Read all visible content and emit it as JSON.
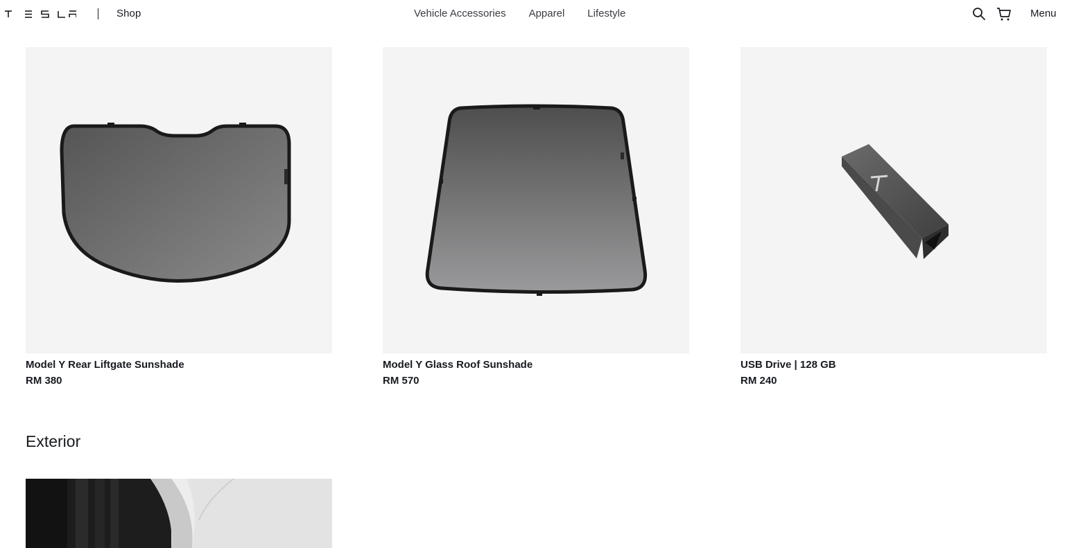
{
  "header": {
    "shop_label": "Shop",
    "nav": [
      "Vehicle Accessories",
      "Apparel",
      "Lifestyle"
    ],
    "menu_label": "Menu",
    "icons": [
      "tesla-logo",
      "search-icon",
      "cart-icon"
    ]
  },
  "products": [
    {
      "name": "Model Y Rear Liftgate Sunshade",
      "price": "RM 380",
      "image": "liftgate-sunshade-image"
    },
    {
      "name": "Model Y Glass Roof Sunshade",
      "price": "RM 570",
      "image": "glass-roof-sunshade-image"
    },
    {
      "name": "USB Drive | 128 GB",
      "price": "RM 240",
      "image": "usb-drive-image"
    }
  ],
  "sections": {
    "exterior_title": "Exterior"
  },
  "colors": {
    "text": "#171a20",
    "image_bg": "#f4f4f4"
  }
}
